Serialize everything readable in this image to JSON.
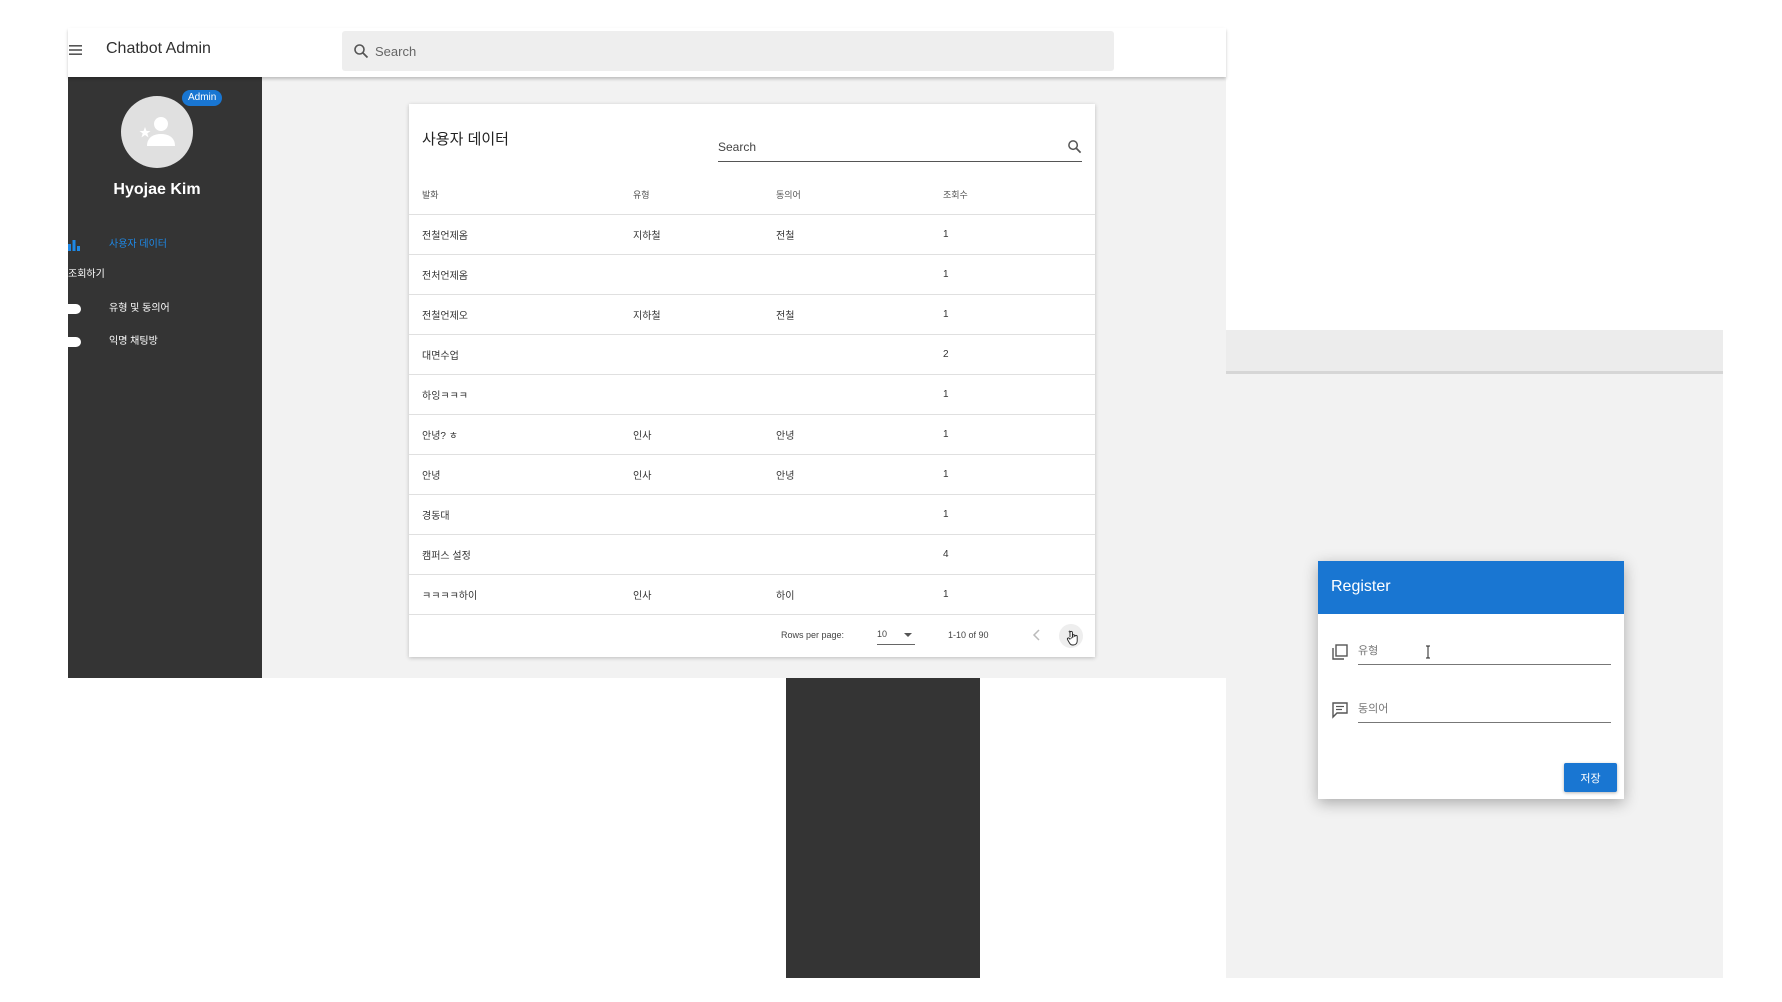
{
  "app": {
    "title": "Chatbot Admin",
    "search_placeholder": "Search"
  },
  "sidebar": {
    "admin_badge": "Admin",
    "user_name": "Hyojae Kim",
    "items": [
      {
        "label": "사용자 데이터",
        "icon": "bar-chart-icon",
        "active": true
      },
      {
        "label": "조회하기",
        "icon": "",
        "active": false
      },
      {
        "label": "유형 및 동의어",
        "icon": "toggle-icon",
        "active": false
      },
      {
        "label": "익명 채팅방",
        "icon": "toggle-icon",
        "active": false
      }
    ]
  },
  "card": {
    "title": "사용자 데이터",
    "search_placeholder": "Search",
    "columns": [
      "발화",
      "유형",
      "동의어",
      "조회수"
    ],
    "rows": [
      {
        "utterance": "전철언제옴",
        "type": "지하철",
        "synonym": "전철",
        "views": "1"
      },
      {
        "utterance": "전처언제옴",
        "type": "",
        "synonym": "",
        "views": "1"
      },
      {
        "utterance": "전철언제오",
        "type": "지하철",
        "synonym": "전철",
        "views": "1"
      },
      {
        "utterance": "대면수업",
        "type": "",
        "synonym": "",
        "views": "2"
      },
      {
        "utterance": "하잉ㅋㅋㅋ",
        "type": "",
        "synonym": "",
        "views": "1"
      },
      {
        "utterance": "안녕? ㅎ",
        "type": "인사",
        "synonym": "안녕",
        "views": "1"
      },
      {
        "utterance": "안녕",
        "type": "인사",
        "synonym": "안녕",
        "views": "1"
      },
      {
        "utterance": "경동대",
        "type": "",
        "synonym": "",
        "views": "1"
      },
      {
        "utterance": "캠퍼스 설정",
        "type": "",
        "synonym": "",
        "views": "4"
      },
      {
        "utterance": "ㅋㅋㅋㅋ하이",
        "type": "인사",
        "synonym": "하이",
        "views": "1"
      }
    ],
    "pagination": {
      "rows_per_page_label": "Rows per page:",
      "rows_per_page": "10",
      "range": "1-10 of 90"
    }
  },
  "dialog": {
    "title": "Register",
    "type_placeholder": "유형",
    "synonym_placeholder": "동의어",
    "save_label": "저장"
  },
  "colors": {
    "primary": "#1976d2",
    "sidebar_bg": "#343434",
    "content_bg": "#f2f2f2"
  }
}
